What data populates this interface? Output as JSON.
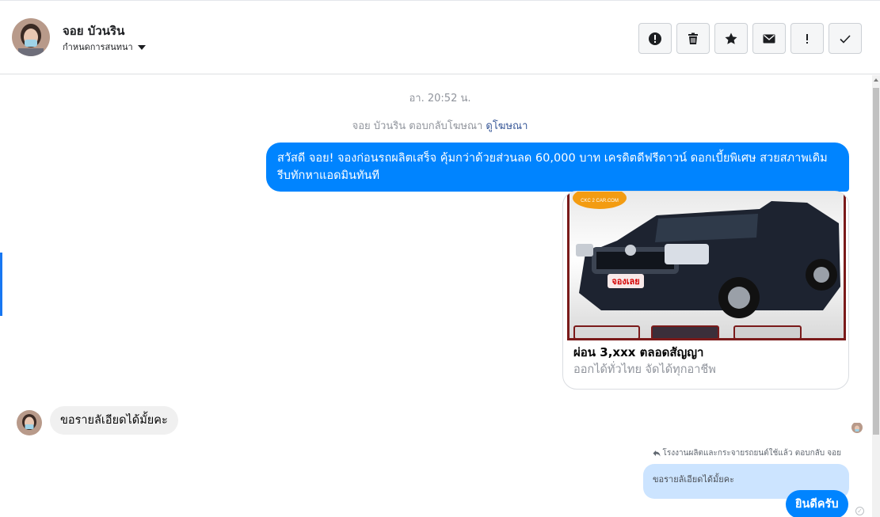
{
  "header": {
    "contact_name": "จอย บัวนริน",
    "assign_label": "กำหนดการสนทนา",
    "actions": [
      {
        "name": "spam-icon",
        "label": "!"
      },
      {
        "name": "trash-icon"
      },
      {
        "name": "star-icon"
      },
      {
        "name": "mail-icon"
      },
      {
        "name": "follow-up-icon",
        "label": "!"
      },
      {
        "name": "done-icon"
      }
    ]
  },
  "thread": {
    "timestamp": "อา. 20:52 น.",
    "reply_note": "จอย บัวนริน ตอบกลับโฆษณา",
    "reply_link": "ดูโฆษณา",
    "ad_message": "สวัสดี จอย! จองก่อนรถผลิตเสร็จ คุ้มกว่าด้วยส่วนลด 60,000 บาท เครดิตดีฟรีดาวน์ ดอกเบี้ยพิเศษ สวยสภาพเดิม รีบทักหาแอดมินทันที",
    "card": {
      "brand": "CKC 2 CAR.COM",
      "badge": "จองเลย",
      "title": "ผ่อน 3,xxx ตลอดสัญญา",
      "subtitle": "ออกได้ทั่วไทย จัดได้ทุกอาชีพ"
    },
    "customer_message": "ขอรายลัเอียดได้มั้ยคะ",
    "page_reply_note": "โรงงานผลิตและกระจายรถยนต์ใช้แล้ว ตอบกลับ จอย",
    "quoted_message": "ขอรายลัเอียดได้มั้ยคะ",
    "page_reply": "ยินดีครับ"
  },
  "colors": {
    "messenger_blue": "#0084ff",
    "accent": "#1877f2",
    "quoted_bg": "#cce4ff"
  }
}
